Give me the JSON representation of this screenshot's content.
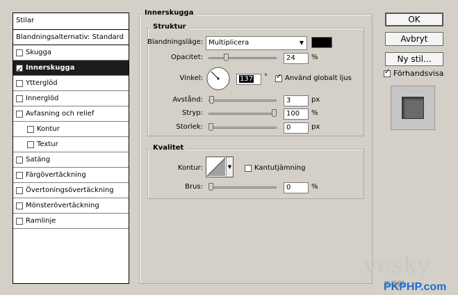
{
  "styles": {
    "header": "Stilar",
    "blending_options": "Blandningsalternativ: Standard",
    "items": [
      {
        "label": "Skugga",
        "checked": false,
        "selected": false,
        "sub": false
      },
      {
        "label": "Innerskugga",
        "checked": true,
        "selected": true,
        "sub": false
      },
      {
        "label": "Ytterglöd",
        "checked": false,
        "selected": false,
        "sub": false
      },
      {
        "label": "Innerglöd",
        "checked": false,
        "selected": false,
        "sub": false
      },
      {
        "label": "Avfasning och relief",
        "checked": false,
        "selected": false,
        "sub": false
      },
      {
        "label": "Kontur",
        "checked": false,
        "selected": false,
        "sub": true
      },
      {
        "label": "Textur",
        "checked": false,
        "selected": false,
        "sub": true
      },
      {
        "label": "Satäng",
        "checked": false,
        "selected": false,
        "sub": false
      },
      {
        "label": "Färgövertäckning",
        "checked": false,
        "selected": false,
        "sub": false
      },
      {
        "label": "Övertoningsövertäckning",
        "checked": false,
        "selected": false,
        "sub": false
      },
      {
        "label": "Mönsterövertäckning",
        "checked": false,
        "selected": false,
        "sub": false
      },
      {
        "label": "Ramlinje",
        "checked": false,
        "selected": false,
        "sub": false
      }
    ]
  },
  "inner_shadow": {
    "title": "Innerskugga",
    "structure": {
      "title": "Struktur",
      "blend_mode_label": "Blandningsläge:",
      "blend_mode_value": "Multiplicera",
      "shadow_color": "#000000",
      "opacity_label": "Opacitet:",
      "opacity_value": "24",
      "opacity_unit": "%",
      "opacity_level": 0.24,
      "angle_label": "Vinkel:",
      "angle_value": "137",
      "angle_unit": "°",
      "global_light_label": "Använd globalt ljus",
      "global_light_checked": true,
      "distance_label": "Avstånd:",
      "distance_value": "3",
      "distance_unit": "px",
      "distance_level": 0.01,
      "choke_label": "Stryp:",
      "choke_value": "100",
      "choke_unit": "%",
      "choke_level": 1.0,
      "size_label": "Storlek:",
      "size_value": "0",
      "size_unit": "px",
      "size_level": 0.0
    },
    "quality": {
      "title": "Kvalitet",
      "contour_label": "Kontur:",
      "antialias_label": "Kantutjämning",
      "antialias_checked": false,
      "noise_label": "Brus:",
      "noise_value": "0",
      "noise_unit": "%",
      "noise_level": 0.0
    }
  },
  "buttons": {
    "ok": "OK",
    "cancel": "Avbryt",
    "new_style": "Ny stil...",
    "preview_label": "Förhandsvisa",
    "preview_checked": true
  },
  "watermark": {
    "line1": "yesky",
    "line2": "天极网",
    "line3": "PKPHP.com"
  }
}
